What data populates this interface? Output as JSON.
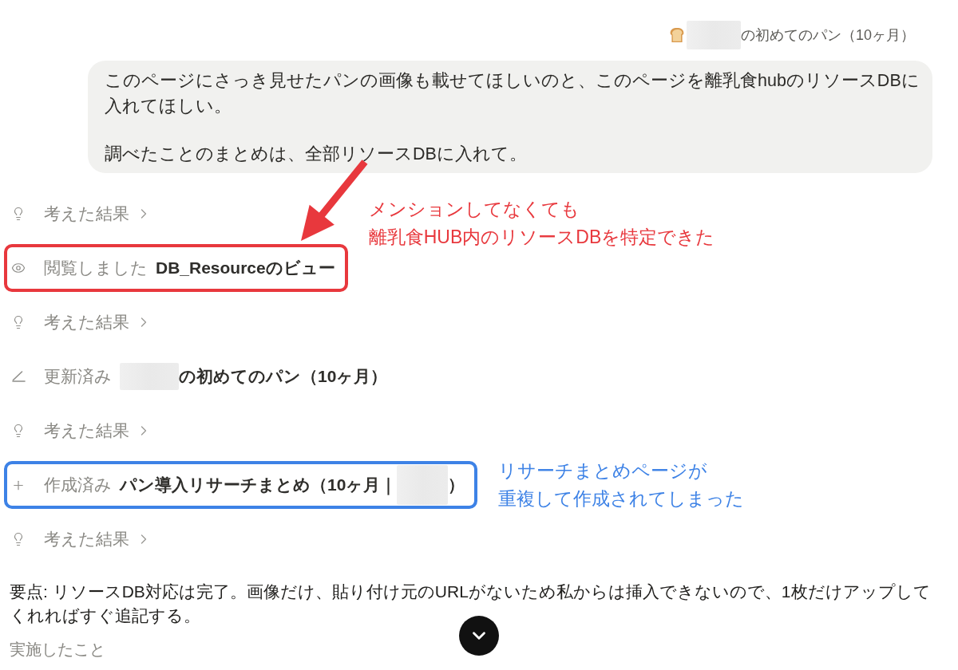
{
  "page_chip": {
    "title": [
      {
        "kind": "redacted"
      },
      {
        "kind": "text",
        "text": "の初めてのパン（10ヶ月）"
      }
    ]
  },
  "message": {
    "paragraphs": [
      "このページにさっき見せたパンの画像も載せてほしいのと、このページを離乳食hubのリソースDBに入れてほしい。",
      "調べたことのまとめは、全部リソースDBに入れて。"
    ]
  },
  "steps": [
    {
      "kind": "thought",
      "label": "考えた結果",
      "expanded": false
    },
    {
      "kind": "viewed",
      "label": "閲覧しました",
      "target": [
        {
          "kind": "text",
          "text": "DB_Resourceのビュー"
        }
      ],
      "annotation": {
        "kind": "arrow",
        "color": "#e8383d",
        "lines": [
          "メンションしてなくても",
          "離乳食HUB内のリソースDBを特定できた"
        ]
      }
    },
    {
      "kind": "thought",
      "label": "考えた結果",
      "expanded": false
    },
    {
      "kind": "updated",
      "label": "更新済み",
      "target": [
        {
          "kind": "redacted"
        },
        {
          "kind": "text",
          "text": "の初めてのパン（10ヶ月）"
        }
      ]
    },
    {
      "kind": "thought",
      "label": "考えた結果",
      "expanded": false
    },
    {
      "kind": "created",
      "label": "作成済み",
      "target": [
        {
          "kind": "text",
          "text": "パン導入リサーチまとめ（10ヶ月｜"
        },
        {
          "kind": "redacted"
        },
        {
          "kind": "text",
          "text": "）"
        }
      ],
      "annotation": {
        "kind": "side",
        "color": "#3d82e6",
        "lines": [
          "リサーチまとめページが",
          "重複して作成されてしまった"
        ]
      }
    },
    {
      "kind": "thought",
      "label": "考えた結果",
      "expanded": false
    }
  ],
  "summary": "要点: リソースDB対応は完了。画像だけ、貼り付け元のURLがないため私からは挿入できないので、1枚だけアップしてくれればすぐ追記する。",
  "section_label": "実施したこと"
}
